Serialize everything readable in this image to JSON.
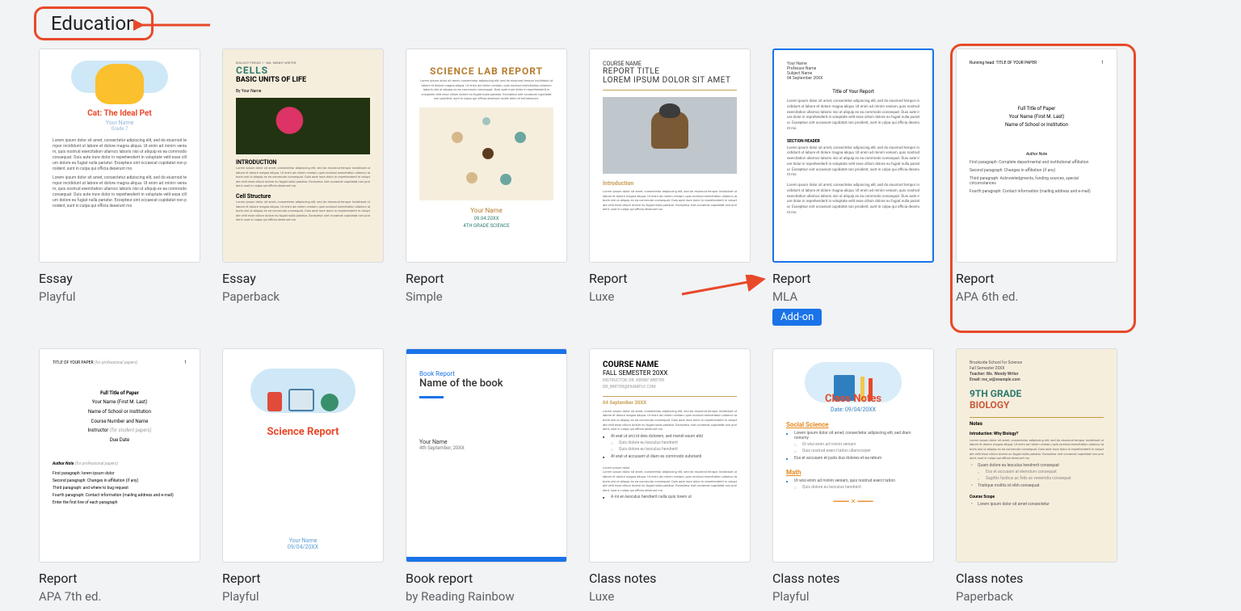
{
  "section_title": "Education",
  "lorem": "Lorem ipsum dolor sit amet, consectetur adipiscing elit, sed do eiusmod tempor incididunt ut labore et dolore magna aliqua. Ut enim ad minim veniam, quis nostrud exercitation ullamco laboris nisi ut aliquip ex ea commodo consequat. Duis aute irure dolor in reprehenderit in voluptate velit esse cillum dolore eu fugiat nulla pariatur. Excepteur sint occaecat cupidatat non proident, sunt in culpa qui officia deserunt mollit anim id est laborum.",
  "templates": [
    {
      "title": "Essay",
      "subtitle": "Playful",
      "addon": false
    },
    {
      "title": "Essay",
      "subtitle": "Paperback",
      "addon": false
    },
    {
      "title": "Report",
      "subtitle": "Simple",
      "addon": false
    },
    {
      "title": "Report",
      "subtitle": "Luxe",
      "addon": false
    },
    {
      "title": "Report",
      "subtitle": "MLA",
      "addon": true
    },
    {
      "title": "Report",
      "subtitle": "APA 6th ed.",
      "addon": false
    },
    {
      "title": "Report",
      "subtitle": "APA 7th ed.",
      "addon": false
    },
    {
      "title": "Report",
      "subtitle": "Playful",
      "addon": false
    },
    {
      "title": "Book report",
      "subtitle": "by Reading Rainbow",
      "addon": false
    },
    {
      "title": "Class notes",
      "subtitle": "Luxe",
      "addon": false
    },
    {
      "title": "Class notes",
      "subtitle": "Playful",
      "addon": false
    },
    {
      "title": "Class notes",
      "subtitle": "Paperback",
      "addon": false
    }
  ],
  "addon_label": "Add-on",
  "content": {
    "playful_essay": {
      "title": "Cat: The Ideal Pet",
      "name": "Your Name",
      "grade": "Grade 7"
    },
    "paperback": {
      "tag": "BIOLOGY PERIOD 1 • MS. WENDY WRITER",
      "h1": "CELLS",
      "h2": "BASIC UNITS OF LIFE",
      "by": "By Your Name",
      "intro": "INTRODUCTION",
      "cell": "Cell Structure"
    },
    "simple": {
      "title": "SCIENCE LAB REPORT",
      "name": "Your Name",
      "date": "09.04.20XX",
      "grade": "4TH GRADE SCIENCE"
    },
    "luxe": {
      "course": "COURSE NAME",
      "h1a": "REPORT TITLE",
      "h1b": "LOREM IPSUM DOLOR SIT AMET",
      "intro": "Introduction"
    },
    "mla": {
      "l1": "Your Name",
      "l2": "Professor Name",
      "l3": "Subject Name",
      "l4": "04 September 20XX",
      "title": "Title of Your Report",
      "sec": "SECTION HEADER"
    },
    "apa6": {
      "run": "Running head: TITLE OF YOUR PAPER",
      "pg": "1",
      "t1": "Full Title of Paper",
      "t2": "Your Name (First M. Last)",
      "t3": "Name of School or Institution",
      "note": "Author Note",
      "p1": "First paragraph: Complete departmental and institutional affiliation",
      "p2": "Second paragraph: Changes in affiliation (if any)",
      "p3": "Third paragraph: Acknowledgments, funding sources, special circumstances",
      "p4": "Fourth paragraph: Contact information (mailing address and e-mail)"
    },
    "apa7": {
      "run": "TITLE OF YOUR PAPER",
      "pg": "1",
      "hint_a": "(for professional papers)",
      "t1": "Full Title of Paper",
      "t2": "Your Name (First M. Last)",
      "t3": "Name of School or Institution",
      "t4": "Course Number and Name",
      "t5": "Instructor",
      "t6": "Due Date",
      "hint_b": "(for student papers)",
      "note": "Author Note",
      "hint_c": "(for professional papers)"
    },
    "playful_report": {
      "title": "Science Report",
      "name": "Your Name",
      "date": "09/04/20XX"
    },
    "book": {
      "label": "Book Report",
      "h1": "Name of the book",
      "name": "Your Name",
      "date": "4th September, 20XX"
    },
    "class_luxe": {
      "h1": "COURSE NAME",
      "h2": "FALL SEMESTER 20XX",
      "sub": "INSTRUCTOR: DR. KENNY WRITER",
      "mail": "DR_WRITER@EXAMPLE.COM",
      "date": "04 September 20XX"
    },
    "class_playful": {
      "title": "Class Notes",
      "date": "Date: 09/04/20XX",
      "sec1": "Social Science",
      "sec2": "Math"
    },
    "class_paper": {
      "l1": "Brookside School for Science",
      "l2": "Fall Semester 20XX",
      "l3": "Teacher: Ms. Wendy Writer",
      "l4": "Email: ms_w@example.com",
      "h1": "9TH GRADE",
      "h2": "BIOLOGY",
      "notes": "Notes",
      "sec": "Introduction: Why Biology?",
      "types": "Course Scope"
    }
  }
}
